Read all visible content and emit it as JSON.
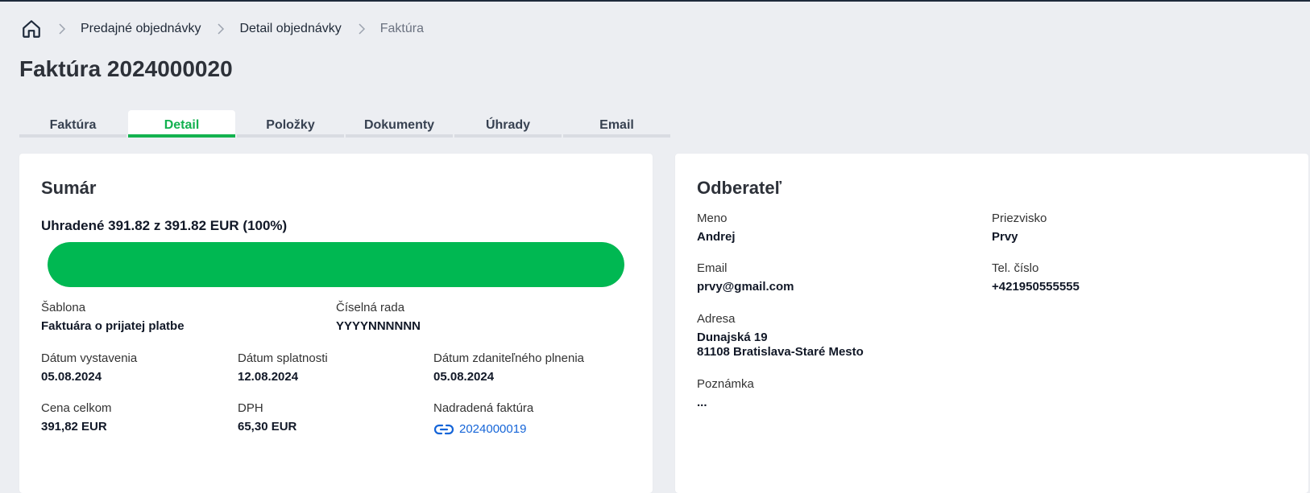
{
  "breadcrumb": {
    "items": [
      "Predajné objednávky",
      "Detail objednávky"
    ],
    "current": "Faktúra"
  },
  "page": {
    "title": "Faktúra 2024000020"
  },
  "tabs": [
    {
      "label": "Faktúra",
      "active": false
    },
    {
      "label": "Detail",
      "active": true
    },
    {
      "label": "Položky",
      "active": false
    },
    {
      "label": "Dokumenty",
      "active": false
    },
    {
      "label": "Úhrady",
      "active": false
    },
    {
      "label": "Email",
      "active": false
    }
  ],
  "summary": {
    "title": "Sumár",
    "paid_text": "Uhradené 391.82 z 391.82 EUR (100%)",
    "paid_fraction": 1.0,
    "template_label": "Šablona",
    "template_value": "Faktuára o prijatej platbe",
    "series_label": "Číselná rada",
    "series_value": "YYYYNNNNNN",
    "issue_date_label": "Dátum vystavenia",
    "issue_date_value": "05.08.2024",
    "due_date_label": "Dátum splatnosti",
    "due_date_value": "12.08.2024",
    "tax_date_label": "Dátum zdaniteľného plnenia",
    "tax_date_value": "05.08.2024",
    "total_label": "Cena celkom",
    "total_value": "391,82 EUR",
    "vat_label": "DPH",
    "vat_value": "65,30 EUR",
    "parent_label": "Nadradená faktúra",
    "parent_value": "2024000019"
  },
  "customer": {
    "title": "Odberateľ",
    "name_label": "Meno",
    "name_value": "Andrej",
    "surname_label": "Priezvisko",
    "surname_value": "Prvy",
    "email_label": "Email",
    "email_value": "prvy@gmail.com",
    "phone_label": "Tel. číslo",
    "phone_value": "+421950555555",
    "address_label": "Adresa",
    "address_lines": [
      "Dunajská 19",
      "81108 Bratislava-Staré Mesto"
    ],
    "note_label": "Poznámka",
    "note_value": "..."
  },
  "colors": {
    "accent_green": "#00b852",
    "link_blue": "#1565d8",
    "background": "#eceef2"
  },
  "icons": {
    "home": "home-icon",
    "separator": "chevron-right-icon",
    "link": "link-icon"
  }
}
